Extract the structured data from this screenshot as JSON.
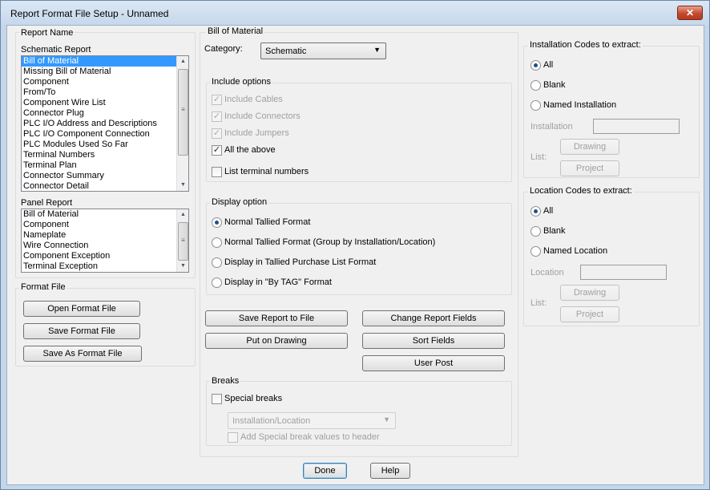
{
  "window": {
    "title": "Report Format File Setup - Unnamed",
    "close": "✕"
  },
  "report_name": {
    "label": "Report Name",
    "schematic_label": "Schematic Report",
    "schematic_items": [
      "Bill of Material",
      "Missing Bill of Material",
      "Component",
      "From/To",
      "Component Wire List",
      "Connector Plug",
      "PLC I/O Address and Descriptions",
      "PLC I/O Component Connection",
      "PLC Modules Used So Far",
      "Terminal Numbers",
      "Terminal Plan",
      "Connector Summary",
      "Connector Detail"
    ],
    "panel_label": "Panel Report",
    "panel_items": [
      "Bill of Material",
      "Component",
      "Nameplate",
      "Wire Connection",
      "Component Exception",
      "Terminal Exception"
    ]
  },
  "format_file": {
    "label": "Format File",
    "open": "Open Format File",
    "save": "Save Format File",
    "save_as": "Save As Format File"
  },
  "bom": {
    "label": "Bill of Material",
    "category_label": "Category:",
    "category_value": "Schematic",
    "include": {
      "label": "Include options",
      "cables": "Include Cables",
      "connectors": "Include Connectors",
      "jumpers": "Include Jumpers",
      "all": "All the above",
      "list_terminal": "List terminal numbers"
    },
    "display": {
      "label": "Display option",
      "normal": "Normal Tallied Format",
      "group": "Normal Tallied Format (Group by Installation/Location)",
      "purchase": "Display in Tallied Purchase List Format",
      "bytag": "Display in \"By TAG\" Format"
    },
    "buttons": {
      "save_report": "Save Report to File",
      "put_drawing": "Put on Drawing",
      "change_fields": "Change Report Fields",
      "sort_fields": "Sort Fields",
      "user_post": "User Post"
    },
    "breaks": {
      "label": "Breaks",
      "special": "Special breaks",
      "combo_value": "Installation/Location",
      "add_values": "Add Special break values to header"
    }
  },
  "installation": {
    "label": "Installation Codes to extract:",
    "all": "All",
    "blank": "Blank",
    "named": "Named Installation",
    "field_label": "Installation",
    "list_label": "List:",
    "drawing": "Drawing",
    "project": "Project"
  },
  "location": {
    "label": "Location Codes to extract:",
    "all": "All",
    "blank": "Blank",
    "named": "Named Location",
    "field_label": "Location",
    "list_label": "List:",
    "drawing": "Drawing",
    "project": "Project"
  },
  "footer": {
    "done": "Done",
    "help": "Help"
  }
}
